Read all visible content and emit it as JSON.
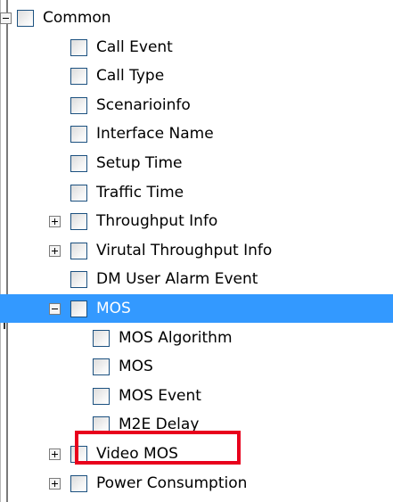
{
  "tree": {
    "items": [
      {
        "label": "Common",
        "expander": "minus",
        "depth": 0
      },
      {
        "label": "Call Event",
        "expander": null,
        "depth": 1
      },
      {
        "label": "Call Type",
        "expander": null,
        "depth": 1
      },
      {
        "label": "Scenarioinfo",
        "expander": null,
        "depth": 1
      },
      {
        "label": "Interface Name",
        "expander": null,
        "depth": 1
      },
      {
        "label": "Setup Time",
        "expander": null,
        "depth": 1
      },
      {
        "label": "Traffic Time",
        "expander": null,
        "depth": 1
      },
      {
        "label": "Throughput Info",
        "expander": "plus",
        "depth": 1
      },
      {
        "label": "Virutal Throughput Info",
        "expander": "plus",
        "depth": 1
      },
      {
        "label": "DM User Alarm Event",
        "expander": null,
        "depth": 1
      },
      {
        "label": "MOS",
        "expander": "minus",
        "depth": 1,
        "selected": true
      },
      {
        "label": "MOS Algorithm",
        "expander": null,
        "depth": 2
      },
      {
        "label": "MOS",
        "expander": null,
        "depth": 2
      },
      {
        "label": "MOS Event",
        "expander": null,
        "depth": 2
      },
      {
        "label": "M2E Delay",
        "expander": null,
        "depth": 2,
        "highlighted": true
      },
      {
        "label": "Video MOS",
        "expander": "plus",
        "depth": 1
      },
      {
        "label": "Power Consumption",
        "expander": "plus",
        "depth": 1
      }
    ]
  },
  "colors": {
    "selection": "#3399ff",
    "highlight_border": "#e8001c"
  }
}
